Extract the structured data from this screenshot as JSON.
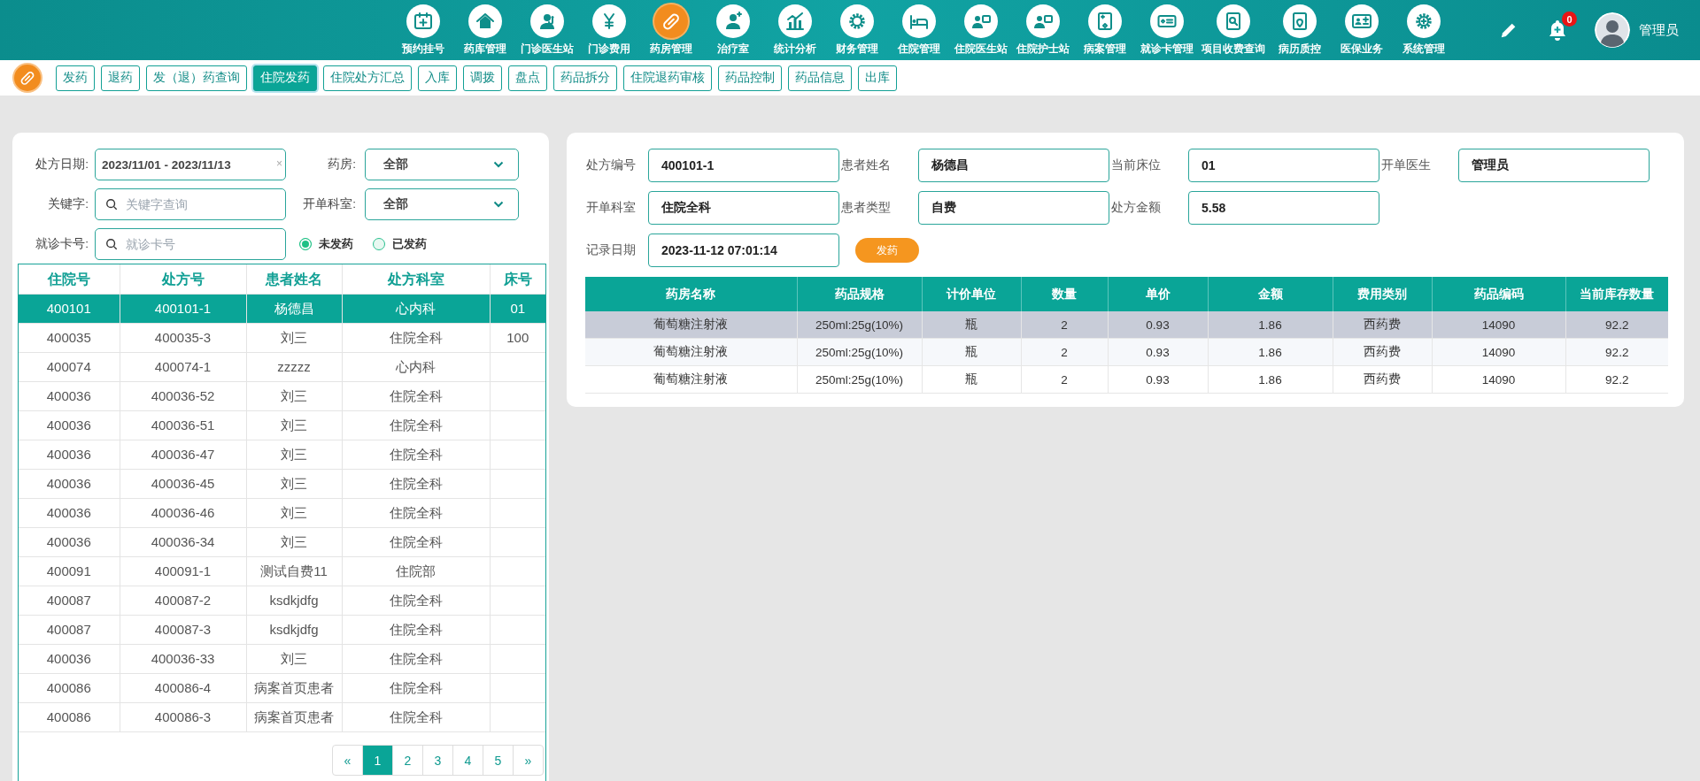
{
  "top_nav": {
    "items": [
      {
        "label": "预约挂号",
        "selected": false
      },
      {
        "label": "药库管理",
        "selected": false
      },
      {
        "label": "门诊医生站",
        "selected": false
      },
      {
        "label": "门诊费用",
        "selected": false
      },
      {
        "label": "药房管理",
        "selected": true
      },
      {
        "label": "治疗室",
        "selected": false
      },
      {
        "label": "统计分析",
        "selected": false
      },
      {
        "label": "财务管理",
        "selected": false
      },
      {
        "label": "住院管理",
        "selected": false
      },
      {
        "label": "住院医生站",
        "selected": false
      },
      {
        "label": "住院护士站",
        "selected": false
      },
      {
        "label": "病案管理",
        "selected": false
      },
      {
        "label": "就诊卡管理",
        "selected": false
      },
      {
        "label": "项目收费查询",
        "selected": false
      },
      {
        "label": "病历质控",
        "selected": false
      },
      {
        "label": "医保业务",
        "selected": false
      },
      {
        "label": "系统管理",
        "selected": false
      }
    ],
    "notification_count": "0",
    "user_name": "管理员"
  },
  "toolbar": {
    "tabs": [
      {
        "label": "发药",
        "selected": false
      },
      {
        "label": "退药",
        "selected": false
      },
      {
        "label": "发（退）药查询",
        "selected": false
      },
      {
        "label": "住院发药",
        "selected": true
      },
      {
        "label": "住院处方汇总",
        "selected": false
      },
      {
        "label": "入库",
        "selected": false
      },
      {
        "label": "调拨",
        "selected": false
      },
      {
        "label": "盘点",
        "selected": false
      },
      {
        "label": "药品拆分",
        "selected": false
      },
      {
        "label": "住院退药审核",
        "selected": false
      },
      {
        "label": "药品控制",
        "selected": false
      },
      {
        "label": "药品信息",
        "selected": false
      },
      {
        "label": "出库",
        "selected": false
      }
    ]
  },
  "filter": {
    "date": {
      "label": "处方日期:",
      "value": "2023/11/01 - 2023/11/13",
      "clear": "×"
    },
    "pharmacy": {
      "label": "药房:",
      "value": "全部"
    },
    "keyword": {
      "label": "关键字:",
      "placeholder": "关键字查询"
    },
    "department": {
      "label": "开单科室:",
      "value": "全部"
    },
    "card_no": {
      "label": "就诊卡号:",
      "placeholder": "就诊卡号"
    },
    "status": [
      {
        "label": "未发药",
        "selected": true
      },
      {
        "label": "已发药",
        "selected": false
      }
    ]
  },
  "prescriptions": {
    "columns": [
      "住院号",
      "处方号",
      "患者姓名",
      "处方科室",
      "床号"
    ],
    "rows": [
      {
        "cells": [
          "400101",
          "400101-1",
          "杨德昌",
          "心内科",
          "01"
        ],
        "selected": true
      },
      {
        "cells": [
          "400035",
          "400035-3",
          "刘三",
          "住院全科",
          "100"
        ],
        "selected": false
      },
      {
        "cells": [
          "400074",
          "400074-1",
          "zzzzz",
          "心内科",
          ""
        ],
        "selected": false
      },
      {
        "cells": [
          "400036",
          "400036-52",
          "刘三",
          "住院全科",
          ""
        ],
        "selected": false
      },
      {
        "cells": [
          "400036",
          "400036-51",
          "刘三",
          "住院全科",
          ""
        ],
        "selected": false
      },
      {
        "cells": [
          "400036",
          "400036-47",
          "刘三",
          "住院全科",
          ""
        ],
        "selected": false
      },
      {
        "cells": [
          "400036",
          "400036-45",
          "刘三",
          "住院全科",
          ""
        ],
        "selected": false
      },
      {
        "cells": [
          "400036",
          "400036-46",
          "刘三",
          "住院全科",
          ""
        ],
        "selected": false
      },
      {
        "cells": [
          "400036",
          "400036-34",
          "刘三",
          "住院全科",
          ""
        ],
        "selected": false
      },
      {
        "cells": [
          "400091",
          "400091-1",
          "测试自费11",
          "住院部",
          ""
        ],
        "selected": false
      },
      {
        "cells": [
          "400087",
          "400087-2",
          "ksdkjdfg",
          "住院全科",
          ""
        ],
        "selected": false
      },
      {
        "cells": [
          "400087",
          "400087-3",
          "ksdkjdfg",
          "住院全科",
          ""
        ],
        "selected": false
      },
      {
        "cells": [
          "400036",
          "400036-33",
          "刘三",
          "住院全科",
          ""
        ],
        "selected": false
      },
      {
        "cells": [
          "400086",
          "400086-4",
          "病案首页患者",
          "住院全科",
          ""
        ],
        "selected": false
      },
      {
        "cells": [
          "400086",
          "400086-3",
          "病案首页患者",
          "住院全科",
          ""
        ],
        "selected": false
      }
    ],
    "pagination": [
      {
        "label": "«",
        "selected": false
      },
      {
        "label": "1",
        "selected": true
      },
      {
        "label": "2",
        "selected": false
      },
      {
        "label": "3",
        "selected": false
      },
      {
        "label": "4",
        "selected": false
      },
      {
        "label": "5",
        "selected": false
      },
      {
        "label": "»",
        "selected": false
      }
    ]
  },
  "detail": {
    "field_rows": [
      [
        {
          "label": "处方编号",
          "value": "400101-1"
        },
        {
          "label": "患者姓名",
          "value": "杨德昌"
        },
        {
          "label": "当前床位",
          "value": "01"
        },
        {
          "label": "开单医生",
          "value": "管理员"
        }
      ],
      [
        {
          "label": "开单科室",
          "value": "住院全科"
        },
        {
          "label": "患者类型",
          "value": "自费"
        },
        {
          "label": "处方金额",
          "value": "5.58"
        }
      ],
      [
        {
          "label": "记录日期",
          "value": "2023-11-12 07:01:14"
        }
      ]
    ],
    "dispense_button": "发药",
    "table": {
      "columns": [
        "药房名称",
        "药品规格",
        "计价单位",
        "数量",
        "单价",
        "金额",
        "费用类别",
        "药品编码",
        "当前库存数量"
      ],
      "rows": [
        {
          "cells": [
            "葡萄糖注射液",
            "250ml:25g(10%)",
            "瓶",
            "2",
            "0.93",
            "1.86",
            "西药费",
            "14090",
            "92.2"
          ],
          "selected": true
        },
        {
          "cells": [
            "葡萄糖注射液",
            "250ml:25g(10%)",
            "瓶",
            "2",
            "0.93",
            "1.86",
            "西药费",
            "14090",
            "92.2"
          ],
          "selected": false
        },
        {
          "cells": [
            "葡萄糖注射液",
            "250ml:25g(10%)",
            "瓶",
            "2",
            "0.93",
            "1.86",
            "西药费",
            "14090",
            "92.2"
          ],
          "selected": false
        }
      ]
    }
  }
}
